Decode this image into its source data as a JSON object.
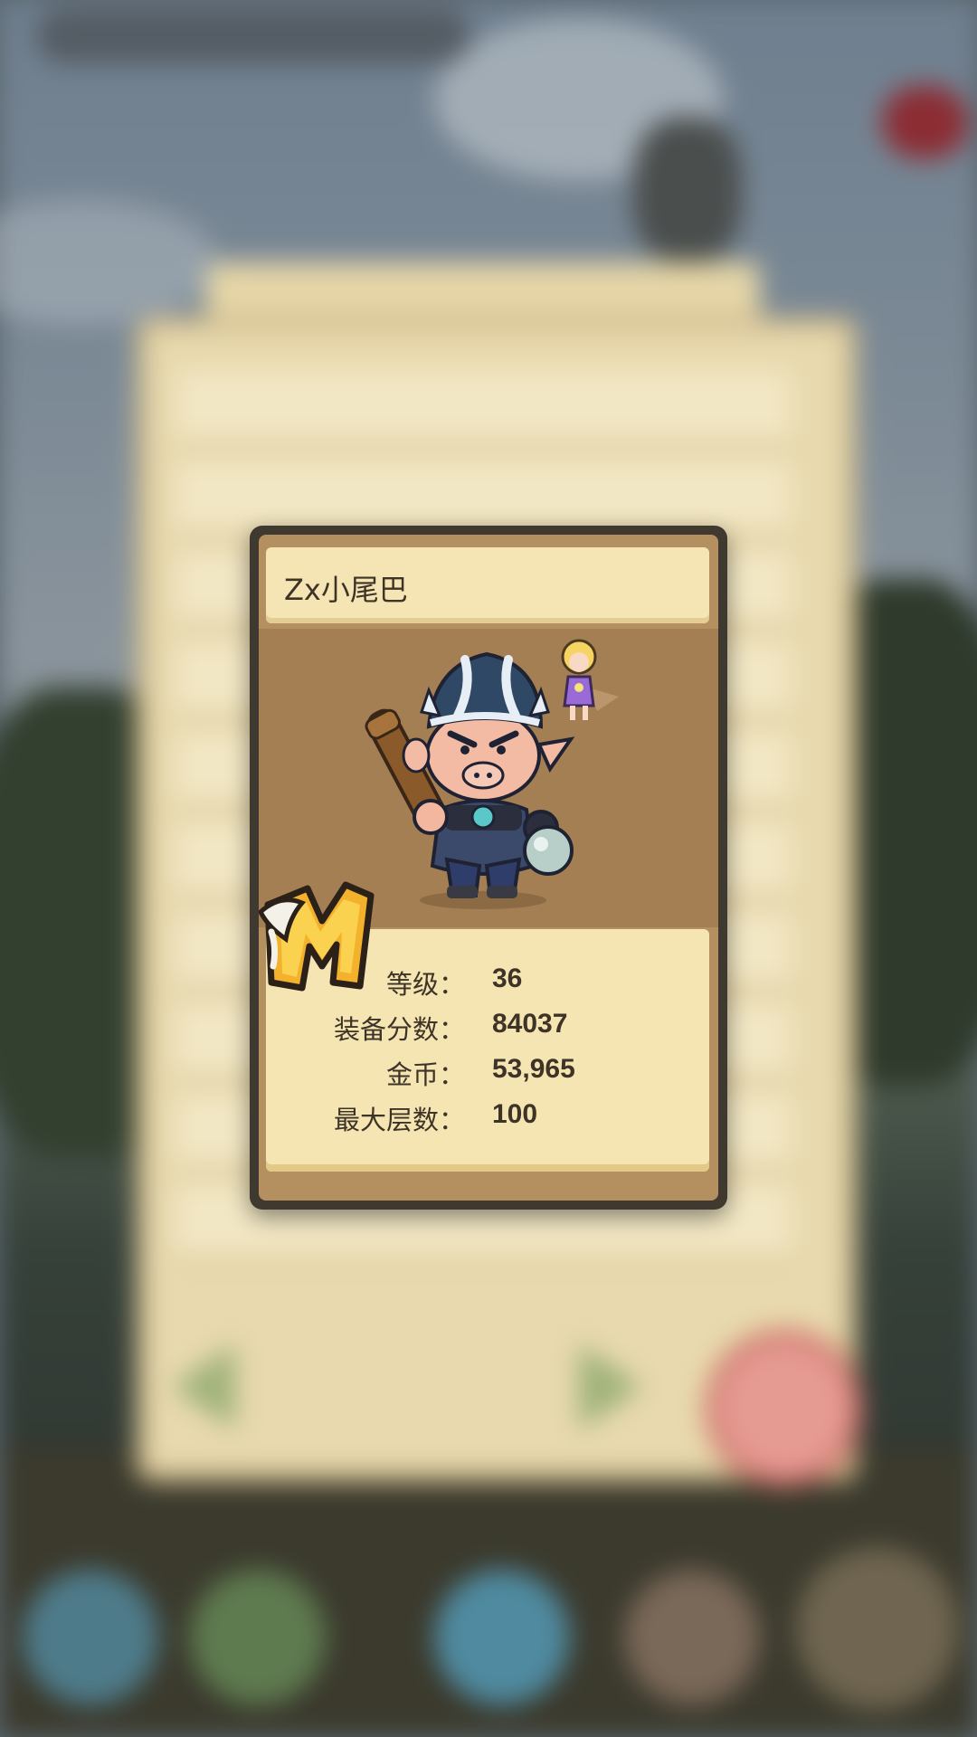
{
  "player": {
    "name": "Zx小尾巴"
  },
  "stats": [
    {
      "label": "等级：",
      "value": "36"
    },
    {
      "label": "装备分数：",
      "value": "84037"
    },
    {
      "label": "金币：",
      "value": "53,965"
    },
    {
      "label": "最大层数：",
      "value": "100"
    }
  ],
  "icons": {
    "rank_badge": "m-badge-icon",
    "character": "pig-warrior-character",
    "pet": "fairy-pet"
  },
  "colors": {
    "card_frame": "#3f3930",
    "card_bg": "#b48f60",
    "panel_bg": "#f5e5b3",
    "text": "#3d3326"
  }
}
